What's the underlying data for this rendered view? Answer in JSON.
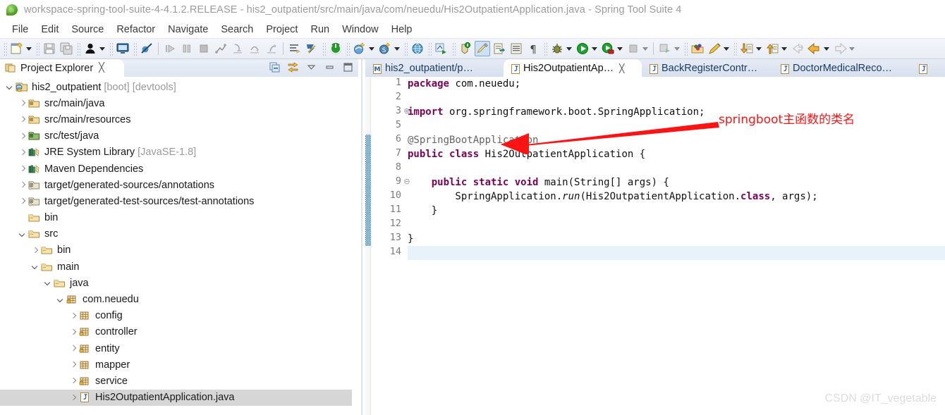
{
  "window": {
    "title": "workspace-spring-tool-suite-4-4.1.2.RELEASE - his2_outpatient/src/main/java/com/neuedu/His2OutpatientApplication.java - Spring Tool Suite 4",
    "app_icon": "spring-leaf-icon"
  },
  "menubar": {
    "items": [
      {
        "label": "File"
      },
      {
        "label": "Edit"
      },
      {
        "label": "Source"
      },
      {
        "label": "Refactor"
      },
      {
        "label": "Navigate"
      },
      {
        "label": "Search"
      },
      {
        "label": "Project"
      },
      {
        "label": "Run"
      },
      {
        "label": "Window"
      },
      {
        "label": "Help"
      }
    ]
  },
  "toolbar": {
    "groups": [
      {
        "icons": [
          "new-wizard-icon",
          "dropdown-arrow",
          "save-icon",
          "save-all-icon"
        ]
      },
      {
        "icons": [
          "person-icon",
          "dropdown-arrow"
        ]
      },
      {
        "icons": [
          "console-icon"
        ]
      },
      {
        "icons": [
          "skip-breakpoints-icon"
        ]
      },
      {
        "icons": [
          "resume-icon",
          "suspend-icon",
          "terminate-icon",
          "disconnect-icon",
          "step-into-icon",
          "step-over-icon",
          "step-return-icon"
        ]
      },
      {
        "icons": [
          "toggle-mark-occurrences-icon",
          "open-task-icon"
        ]
      },
      {
        "icons": [
          "boot-dashboard-icon"
        ]
      },
      {
        "icons": [
          "new-spring-project-icon",
          "dropdown-arrow",
          "new-spring-bean-icon",
          "dropdown-arrow"
        ]
      },
      {
        "icons": [
          "new-web-project-icon"
        ]
      },
      {
        "icons": [
          "deploy-icon"
        ]
      },
      {
        "icons": [
          "new-annotation-icon",
          "edit-highlight-icon",
          "export-icon",
          "properties-view-icon",
          "pilcrow-icon"
        ]
      },
      {
        "icons": [
          "debug-icon",
          "dropdown-arrow",
          "run-icon",
          "dropdown-arrow",
          "run-coverage-icon",
          "dropdown-arrow",
          "stop-icon",
          "dropdown-arrow"
        ]
      },
      {
        "icons": [
          "external-tools-icon",
          "dropdown-arrow"
        ]
      },
      {
        "icons": [
          "open-type-icon",
          "search-pencil-icon",
          "dropdown-arrow"
        ]
      },
      {
        "icons": [
          "prev-annotation-icon",
          "dropdown-arrow",
          "next-annotation-icon",
          "dropdown-arrow"
        ]
      },
      {
        "icons": [
          "back-history-icon",
          "back-icon",
          "dropdown-arrow",
          "forward-icon",
          "dropdown-arrow"
        ]
      }
    ]
  },
  "explorer": {
    "tab_label": "Project Explorer",
    "tab_icon": "project-explorer-icon",
    "close_glyph": "╳",
    "tools": [
      "collapse-all-icon",
      "link-with-editor-icon",
      "view-menu-icon",
      "minimize-icon",
      "maximize-icon"
    ],
    "tree": [
      {
        "indent": 0,
        "twisty": "open",
        "icon": "spring-boot-project-icon",
        "label": "his2_outpatient",
        "suffix": " [boot] [devtools]",
        "selected": false
      },
      {
        "indent": 1,
        "twisty": "closed",
        "icon": "source-folder-icon",
        "label": "src/main/java",
        "suffix": "",
        "selected": false
      },
      {
        "indent": 1,
        "twisty": "closed",
        "icon": "source-folder-icon",
        "label": "src/main/resources",
        "suffix": "",
        "selected": false
      },
      {
        "indent": 1,
        "twisty": "closed",
        "icon": "test-source-folder-icon",
        "label": "src/test/java",
        "suffix": "",
        "selected": false
      },
      {
        "indent": 1,
        "twisty": "closed",
        "icon": "library-icon",
        "label": "JRE System Library",
        "suffix": " [JavaSE-1.8]",
        "selected": false
      },
      {
        "indent": 1,
        "twisty": "closed",
        "icon": "library-icon",
        "label": "Maven Dependencies",
        "suffix": "",
        "selected": false
      },
      {
        "indent": 1,
        "twisty": "closed",
        "icon": "generated-source-folder-icon",
        "label": "target/generated-sources/annotations",
        "suffix": "",
        "selected": false
      },
      {
        "indent": 1,
        "twisty": "closed",
        "icon": "generated-source-folder-icon",
        "label": "target/generated-test-sources/test-annotations",
        "suffix": "",
        "selected": false
      },
      {
        "indent": 1,
        "twisty": "none",
        "icon": "folder-icon",
        "label": "bin",
        "suffix": "",
        "selected": false
      },
      {
        "indent": 1,
        "twisty": "open",
        "icon": "folder-icon",
        "label": "src",
        "suffix": "",
        "selected": false
      },
      {
        "indent": 2,
        "twisty": "closed",
        "icon": "folder-icon",
        "label": "bin",
        "suffix": "",
        "selected": false
      },
      {
        "indent": 2,
        "twisty": "open",
        "icon": "folder-icon",
        "label": "main",
        "suffix": "",
        "selected": false
      },
      {
        "indent": 3,
        "twisty": "open",
        "icon": "folder-icon",
        "label": "java",
        "suffix": "",
        "selected": false
      },
      {
        "indent": 4,
        "twisty": "open",
        "icon": "package-locked-icon",
        "label": "com.neuedu",
        "suffix": "",
        "selected": false
      },
      {
        "indent": 5,
        "twisty": "closed",
        "icon": "package-icon",
        "label": "config",
        "suffix": "",
        "selected": false
      },
      {
        "indent": 5,
        "twisty": "closed",
        "icon": "package-locked-icon",
        "label": "controller",
        "suffix": "",
        "selected": false
      },
      {
        "indent": 5,
        "twisty": "closed",
        "icon": "package-locked-icon",
        "label": "entity",
        "suffix": "",
        "selected": false
      },
      {
        "indent": 5,
        "twisty": "closed",
        "icon": "package-icon",
        "label": "mapper",
        "suffix": "",
        "selected": false
      },
      {
        "indent": 5,
        "twisty": "closed",
        "icon": "package-locked-icon",
        "label": "service",
        "suffix": "",
        "selected": false
      },
      {
        "indent": 5,
        "twisty": "closed",
        "icon": "java-file-icon",
        "label": "His2OutpatientApplication.java",
        "suffix": "",
        "selected": true
      }
    ]
  },
  "editor": {
    "tabs": [
      {
        "label": "his2_outpatient/p…",
        "icon": "maven-pom-icon",
        "active": false,
        "closable": false
      },
      {
        "label": "His2OutpatientAp…",
        "icon": "java-file-icon",
        "active": true,
        "closable": true
      },
      {
        "label": "BackRegisterContr…",
        "icon": "java-file-icon",
        "active": false,
        "closable": false
      },
      {
        "label": "DoctorMedicalReco…",
        "icon": "java-file-icon",
        "active": false,
        "closable": false
      },
      {
        "label": "",
        "icon": "java-file-icon",
        "active": false,
        "closable": false
      }
    ],
    "gutter_numbers": [
      "1",
      "2",
      "3",
      "5",
      "6",
      "7",
      "8",
      "9",
      "10",
      "11",
      "12",
      "13",
      "14"
    ],
    "folds": {
      "3": "⊕",
      "9": "⊖"
    },
    "highlight_line": "14",
    "change_bar_from_line": "6",
    "change_bar_to_line": "13",
    "lines": [
      {
        "num": "1",
        "tokens": [
          {
            "t": "package",
            "c": "k"
          },
          {
            "t": " com.neuedu;",
            "c": "pn"
          }
        ]
      },
      {
        "num": "2",
        "tokens": []
      },
      {
        "num": "3",
        "tokens": [
          {
            "t": "import",
            "c": "k"
          },
          {
            "t": " org.springframework.boot.SpringApplication;",
            "c": "pn"
          }
        ]
      },
      {
        "num": "5",
        "tokens": []
      },
      {
        "num": "6",
        "tokens": [
          {
            "t": "@SpringBootApplication",
            "c": "an"
          }
        ]
      },
      {
        "num": "7",
        "tokens": [
          {
            "t": "public class",
            "c": "k"
          },
          {
            "t": " His2OutpatientApplication {",
            "c": "ty"
          }
        ]
      },
      {
        "num": "8",
        "tokens": []
      },
      {
        "num": "9",
        "tokens": [
          {
            "t": "    ",
            "c": "pn"
          },
          {
            "t": "public static void",
            "c": "k"
          },
          {
            "t": " main(String[] args) {",
            "c": "pn"
          }
        ]
      },
      {
        "num": "10",
        "tokens": [
          {
            "t": "        SpringApplication.",
            "c": "pn"
          },
          {
            "t": "run",
            "c": "mi"
          },
          {
            "t": "(His2OutpatientApplication.",
            "c": "pn"
          },
          {
            "t": "class",
            "c": "k"
          },
          {
            "t": ", args);",
            "c": "pn"
          }
        ]
      },
      {
        "num": "11",
        "tokens": [
          {
            "t": "    }",
            "c": "pn"
          }
        ]
      },
      {
        "num": "12",
        "tokens": []
      },
      {
        "num": "13",
        "tokens": [
          {
            "t": "}",
            "c": "pn"
          }
        ]
      },
      {
        "num": "14",
        "tokens": []
      }
    ]
  },
  "annotation": {
    "text": "springboot主函数的类名",
    "color": "#fb1414",
    "arrow": "red-arrow-pointing-left"
  },
  "watermark": {
    "text": "CSDN @IT_vegetable"
  }
}
